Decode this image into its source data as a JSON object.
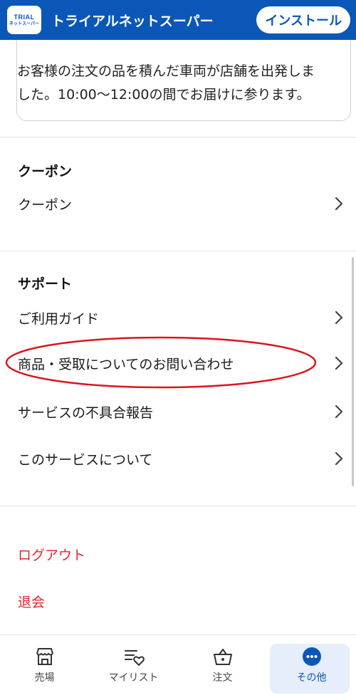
{
  "banner": {
    "logo_line1": "TRIAL",
    "logo_line2": "ネットスーパー",
    "app_name": "トライアルネットスーパー",
    "install_label": "インストール"
  },
  "notice": {
    "text": "お客様の注文の品を積んだ車両が店舗を出発しました。10:00〜12:00の間でお届けに参ります。"
  },
  "coupon_section": {
    "heading": "クーポン",
    "items": [
      {
        "label": "クーポン"
      }
    ]
  },
  "support_section": {
    "heading": "サポート",
    "items": [
      {
        "label": "ご利用ガイド"
      },
      {
        "label": "商品・受取についてのお問い合わせ"
      },
      {
        "label": "サービスの不具合報告"
      },
      {
        "label": "このサービスについて"
      }
    ]
  },
  "account_section": {
    "items": [
      {
        "label": "ログアウト"
      },
      {
        "label": "退会"
      }
    ]
  },
  "bottom_nav": {
    "items": [
      {
        "label": "売場",
        "icon": "store-icon"
      },
      {
        "label": "マイリスト",
        "icon": "mylist-heart-icon"
      },
      {
        "label": "注文",
        "icon": "basket-icon"
      },
      {
        "label": "その他",
        "icon": "more-icon"
      }
    ],
    "active_index": 3
  },
  "colors": {
    "brand_blue": "#0a57b8",
    "danger_red": "#e0262b",
    "highlight_red": "#d9161c"
  }
}
